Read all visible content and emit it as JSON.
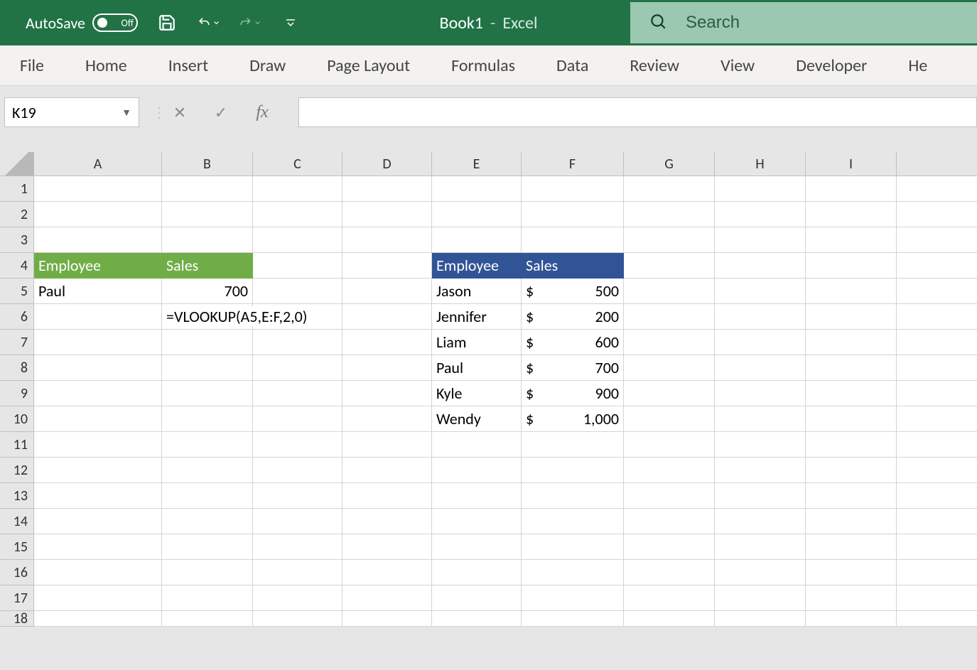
{
  "title_bar": {
    "autosave_label": "AutoSave",
    "autosave_state": "Off",
    "doc_name": "Book1",
    "app_name": "Excel",
    "search_placeholder": "Search"
  },
  "ribbon_tabs": [
    "File",
    "Home",
    "Insert",
    "Draw",
    "Page Layout",
    "Formulas",
    "Data",
    "Review",
    "View",
    "Developer",
    "He"
  ],
  "formula_bar": {
    "name_box": "K19",
    "fx_label": "fx",
    "formula_text": ""
  },
  "columns": [
    "A",
    "B",
    "C",
    "D",
    "E",
    "F",
    "G",
    "H",
    "I",
    ""
  ],
  "row_numbers": [
    "1",
    "2",
    "3",
    "4",
    "5",
    "6",
    "7",
    "8",
    "9",
    "10",
    "11",
    "12",
    "13",
    "14",
    "15",
    "16",
    "17",
    "18"
  ],
  "left_table": {
    "headers": {
      "employee": "Employee",
      "sales": "Sales"
    },
    "row5": {
      "name": "Paul",
      "value": "700"
    },
    "row6_formula": "=VLOOKUP(A5,E:F,2,0)"
  },
  "right_table": {
    "headers": {
      "employee": "Employee",
      "sales": "Sales"
    },
    "rows": [
      {
        "name": "Jason",
        "currency": "$",
        "value": "500"
      },
      {
        "name": "Jennifer",
        "currency": "$",
        "value": "200"
      },
      {
        "name": "Liam",
        "currency": "$",
        "value": "600"
      },
      {
        "name": "Paul",
        "currency": "$",
        "value": "700"
      },
      {
        "name": "Kyle",
        "currency": "$",
        "value": "900"
      },
      {
        "name": "Wendy",
        "currency": "$",
        "value": "1,000"
      }
    ]
  },
  "colors": {
    "green": "#70ad47",
    "blue": "#305496",
    "title": "#217346"
  }
}
